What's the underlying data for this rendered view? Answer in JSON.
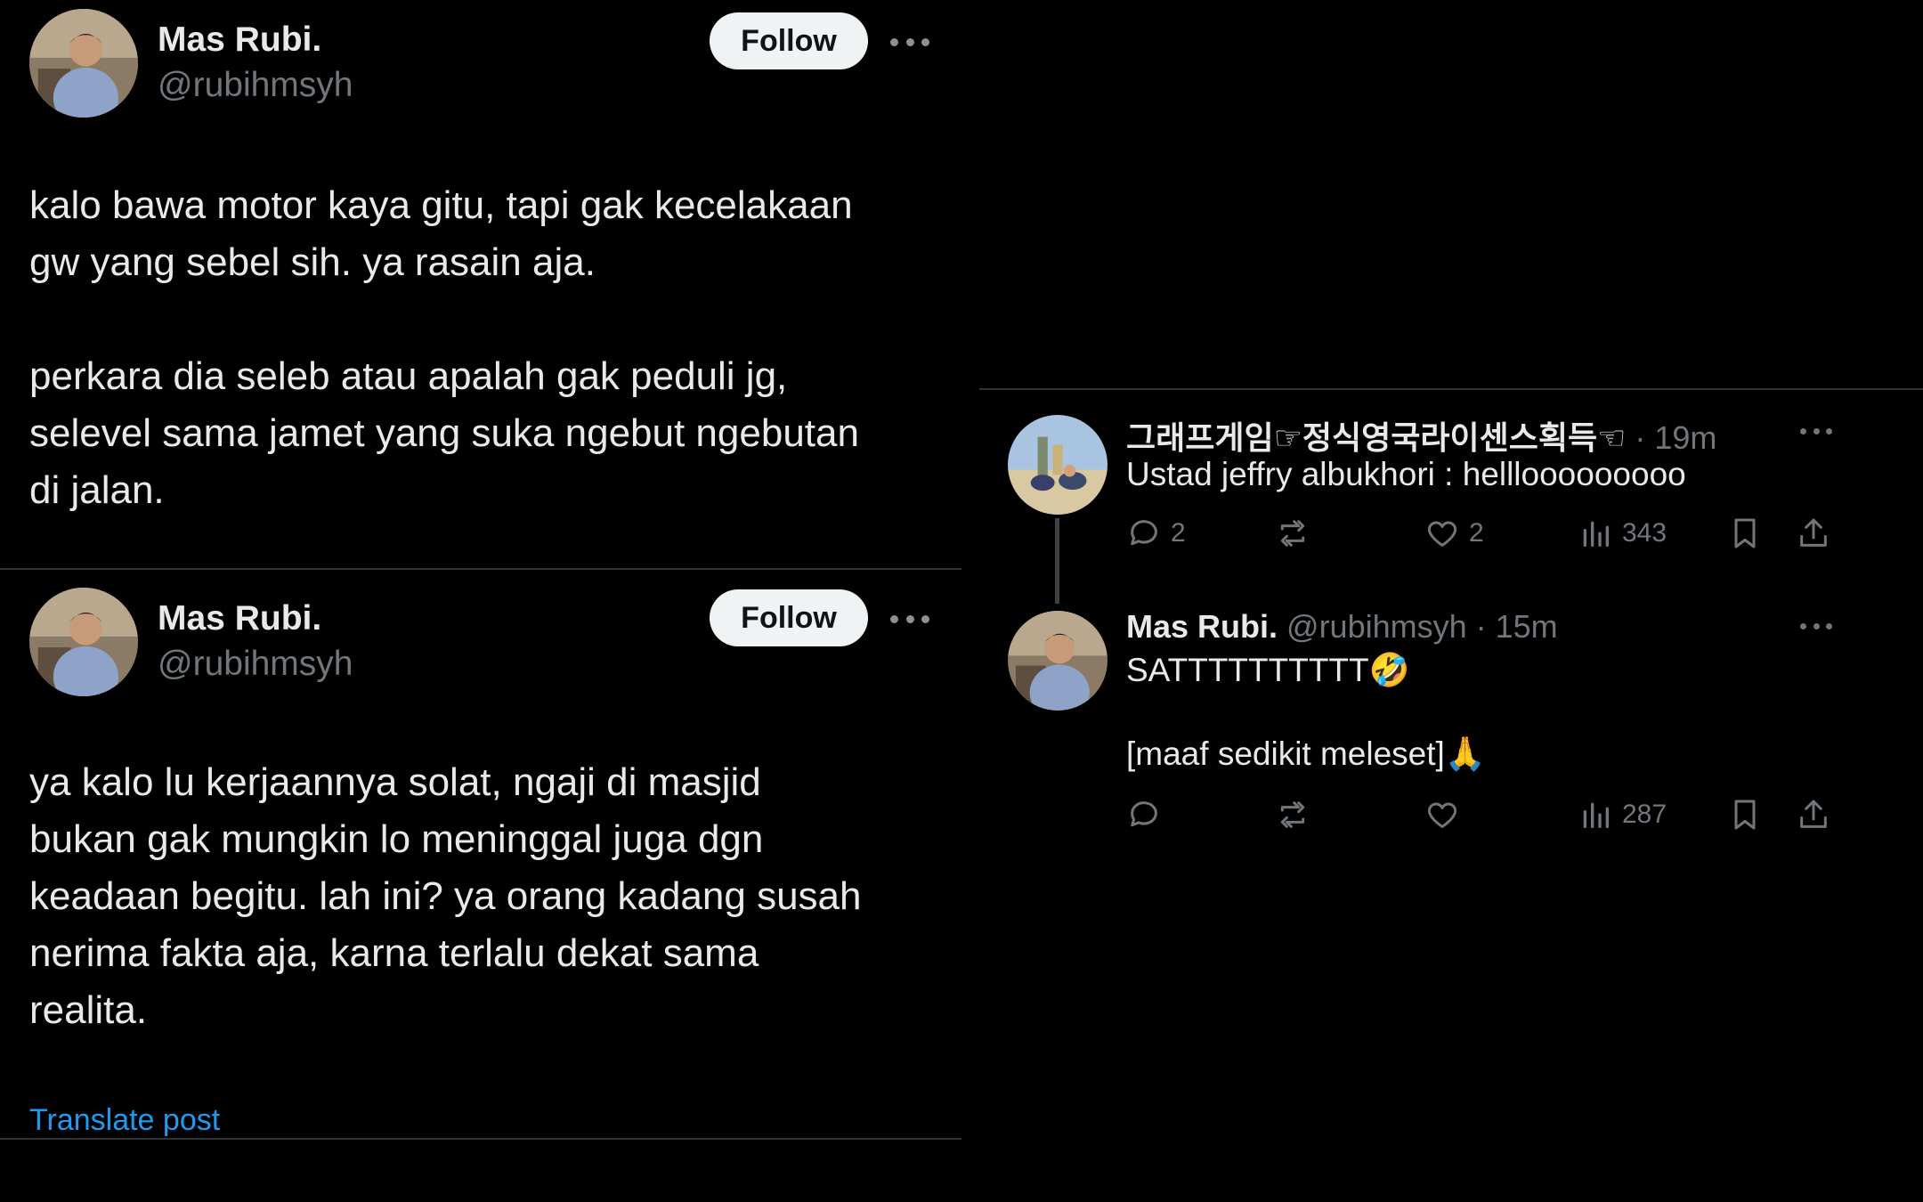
{
  "post1": {
    "author_name": "Mas Rubi.",
    "author_handle": "@rubihmsyh",
    "follow_label": "Follow",
    "text": "kalo bawa motor kaya gitu, tapi gak kecelakaan\ngw yang sebel sih. ya rasain aja.\n\nperkara dia seleb atau apalah gak peduli jg,\nselevel sama jamet yang suka ngebut ngebutan\ndi jalan."
  },
  "post2": {
    "author_name": "Mas Rubi.",
    "author_handle": "@rubihmsyh",
    "follow_label": "Follow",
    "text": "ya kalo lu kerjaannya solat, ngaji di masjid\nbukan gak mungkin lo meninggal juga dgn\nkeadaan begitu. lah ini? ya orang kadang susah\nnerima fakta aja, karna terlalu dekat sama\nrealita.",
    "translate_label": "Translate post"
  },
  "reply1": {
    "author_name": "그래프게임☞정식영국라이센스획득☜",
    "meta": " · 19m",
    "text": "Ustad jeffry albukhori : helllooooooooo",
    "reply_count": "2",
    "like_count": "2",
    "view_count": "343"
  },
  "reply2": {
    "author_name": "Mas Rubi.",
    "meta": " @rubihmsyh · 15m",
    "text_line1": "SATTTTTTTTTT🤣",
    "text_line2": "[maaf sedikit meleset]🙏",
    "view_count": "287"
  },
  "icons": [
    "reply-icon",
    "retweet-icon",
    "like-icon",
    "views-icon",
    "bookmark-icon",
    "share-icon",
    "more-icon"
  ]
}
